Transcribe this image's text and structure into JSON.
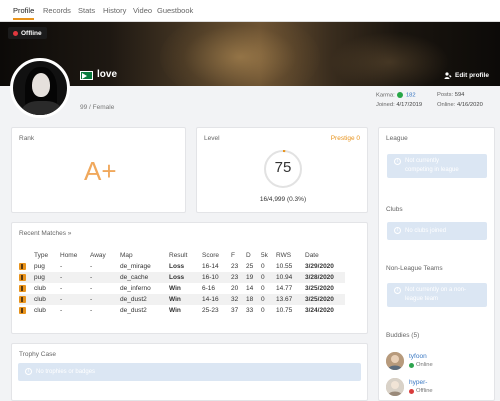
{
  "tabs": [
    "Profile",
    "Records",
    "Stats",
    "History",
    "Video",
    "Guestbook"
  ],
  "banner": {
    "status": "Offline"
  },
  "profile": {
    "username": "love",
    "subline": "99 / Female",
    "edit_label": "Edit profile",
    "karma_label": "Karma:",
    "karma_value": "182",
    "posts_label": "Posts:",
    "posts_value": "594",
    "joined_label": "Joined:",
    "joined_value": "4/17/2019",
    "online_label": "Online:",
    "online_value": "4/16/2020"
  },
  "rank": {
    "title": "Rank",
    "value": "A+"
  },
  "level": {
    "title": "Level",
    "prestige": "Prestige 0",
    "value": "75",
    "xp": "16/4,999 (0.3%)",
    "progress_fraction": 0.003
  },
  "recent_matches": {
    "title": "Recent Matches »",
    "headers": [
      "Type",
      "Home",
      "Away",
      "Map",
      "Result",
      "Score",
      "F",
      "D",
      "5k",
      "RWS",
      "Date"
    ],
    "rows": [
      {
        "type": "pug",
        "home": "-",
        "away": "-",
        "map": "de_mirage",
        "result": "Loss",
        "score": "16-14",
        "f": "23",
        "d": "25",
        "k5": "0",
        "rws": "10.55",
        "date": "3/29/2020"
      },
      {
        "type": "pug",
        "home": "-",
        "away": "-",
        "map": "de_cache",
        "result": "Loss",
        "score": "16-10",
        "f": "23",
        "d": "19",
        "k5": "0",
        "rws": "10.94",
        "date": "3/28/2020"
      },
      {
        "type": "club",
        "home": "-",
        "away": "-",
        "map": "de_inferno",
        "result": "Win",
        "score": "6-16",
        "f": "20",
        "d": "14",
        "k5": "0",
        "rws": "14.77",
        "date": "3/25/2020"
      },
      {
        "type": "club",
        "home": "-",
        "away": "-",
        "map": "de_dust2",
        "result": "Win",
        "score": "14-16",
        "f": "32",
        "d": "18",
        "k5": "0",
        "rws": "13.67",
        "date": "3/25/2020"
      },
      {
        "type": "club",
        "home": "-",
        "away": "-",
        "map": "de_dust2",
        "result": "Win",
        "score": "25-23",
        "f": "37",
        "d": "33",
        "k5": "0",
        "rws": "10.75",
        "date": "3/24/2020"
      }
    ]
  },
  "trophy_case": {
    "title": "Trophy Case",
    "empty": "No trophies or badges"
  },
  "league": {
    "title": "League",
    "empty_line1": "Not currently",
    "empty_line2": "competing in league"
  },
  "clubs": {
    "title": "Clubs",
    "empty": "No clubs joined"
  },
  "non_league": {
    "title": "Non-League Teams",
    "empty_line1": "Not currently on a non-",
    "empty_line2": "league team"
  },
  "buddies": {
    "title": "Buddies (5)",
    "items": [
      {
        "name": "tyfoon",
        "status": "Online",
        "status_color": "#2ea44f"
      },
      {
        "name": "hyper-",
        "status": "Offline",
        "status_color": "#d83b3b"
      }
    ]
  },
  "colors": {
    "accent": "#e8931c",
    "link": "#3a78c3",
    "win": "#2ea44f",
    "loss": "#d83b3b",
    "info_box": "#dbe6f3"
  }
}
